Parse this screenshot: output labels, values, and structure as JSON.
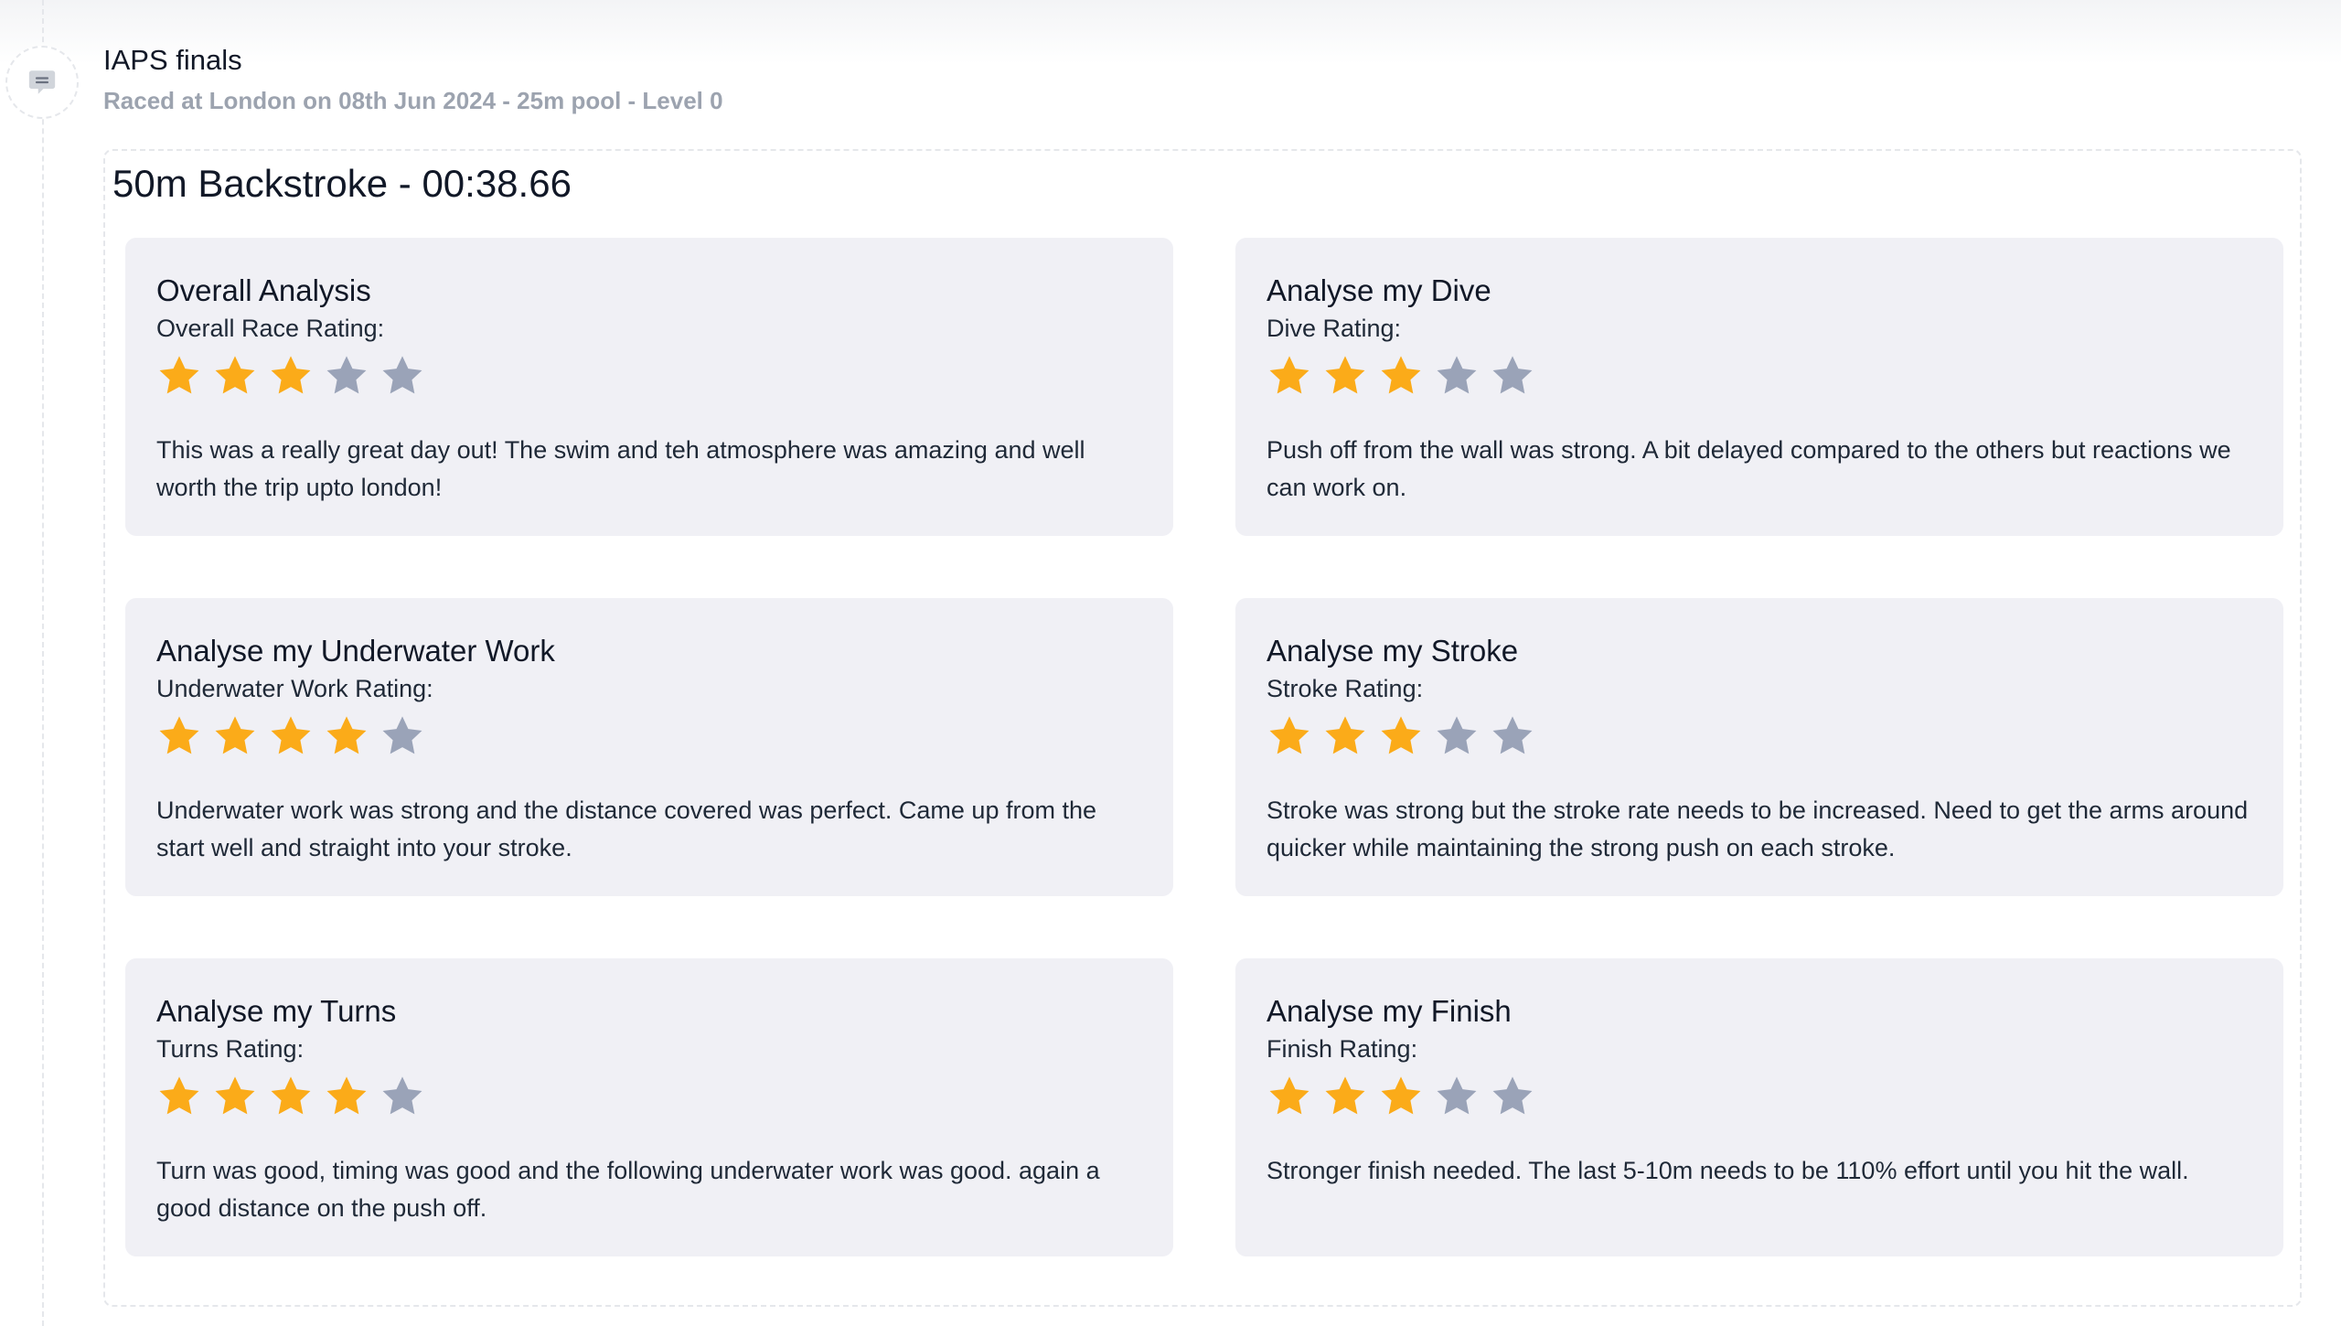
{
  "event": {
    "title": "IAPS finals",
    "subtitle": "Raced at London on 08th Jun 2024 - 25m pool - Level 0",
    "icon": "comment-icon"
  },
  "result": {
    "title": "50m Backstroke - 00:38.66",
    "max_stars": 5,
    "colors": {
      "star_on": "#fbab19",
      "star_off": "#9aa3b8",
      "card_bg": "#f0f0f5"
    },
    "cards": [
      {
        "title": "Overall Analysis",
        "rating_label": "Overall Race Rating:",
        "rating": 3,
        "text": "This was a really great day out! The swim and teh atmosphere was amazing and well worth the trip upto london!"
      },
      {
        "title": "Analyse my Dive",
        "rating_label": "Dive Rating:",
        "rating": 3,
        "text": "Push off from the wall was strong. A bit delayed compared to the others but reactions we can work on."
      },
      {
        "title": "Analyse my Underwater Work",
        "rating_label": "Underwater Work Rating:",
        "rating": 4,
        "text": "Underwater work was strong and the distance covered was perfect. Came up from the start well and straight into your stroke."
      },
      {
        "title": "Analyse my Stroke",
        "rating_label": "Stroke Rating:",
        "rating": 3,
        "text": "Stroke was strong but the stroke rate needs to be increased. Need to get the arms around quicker while maintaining the strong push on each stroke."
      },
      {
        "title": "Analyse my Turns",
        "rating_label": "Turns Rating:",
        "rating": 4,
        "text": "Turn was good, timing was good and the following underwater work was good. again a good distance on the push off."
      },
      {
        "title": "Analyse my Finish",
        "rating_label": "Finish Rating:",
        "rating": 3,
        "text": "Stronger finish needed. The last 5-10m needs to be 110% effort until you hit the wall."
      }
    ]
  }
}
